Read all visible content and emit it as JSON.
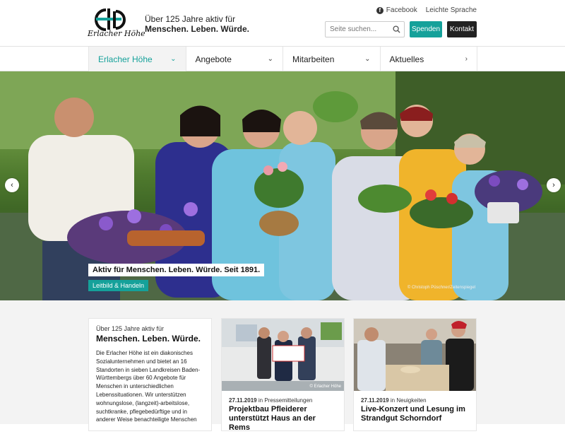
{
  "header": {
    "logo_script": "Erlacher Höhe",
    "tagline_line1": "Über 125 Jahre aktiv für",
    "tagline_line2": "Menschen. Leben. Würde.",
    "facebook_label": "Facebook",
    "easy_language_label": "Leichte Sprache",
    "search_placeholder": "Seite suchen...",
    "donate_label": "Spenden",
    "contact_label": "Kontakt",
    "accent_color": "#15a19a"
  },
  "nav": {
    "items": [
      {
        "label": "Erlacher Höhe",
        "icon": "chevron-down-icon",
        "active": true
      },
      {
        "label": "Angebote",
        "icon": "chevron-down-icon"
      },
      {
        "label": "Mitarbeiten",
        "icon": "chevron-down-icon"
      },
      {
        "label": "Aktuelles",
        "icon": "chevron-right-icon"
      }
    ]
  },
  "hero": {
    "caption": "Aktiv für Menschen. Leben. Würde. Seit 1891.",
    "tag": "Leitbild & Handeln",
    "credit": "© Christoph Püschner/Zeitenspiegel",
    "prev_icon": "chevron-left-icon",
    "next_icon": "chevron-right-icon"
  },
  "intro": {
    "sub": "Über 125 Jahre aktiv für",
    "head": "Menschen. Leben. Würde.",
    "body": "Die Erlacher Höhe ist ein diakonisches Sozialunternehmen und bietet an 16 Standorten in sieben Landkreisen Baden-Württembergs über 60 Angebote für Menschen in unterschiedlichen Lebenssituationen. Wir unterstützen wohnungslose, (langzeit)-arbeitslose, suchtkranke, pflegebedürftige und in anderer Weise benachteiligte Menschen"
  },
  "news": [
    {
      "date": "27.11.2019",
      "category_prefix": "in",
      "category": "Pressemitteilungen",
      "title": "Projektbau Pfleiderer unterstützt Haus an der Rems",
      "img_credit": "© Erlacher Höhe"
    },
    {
      "date": "27.11.2019",
      "category_prefix": "in",
      "category": "Neuigkeiten",
      "title": "Live-Konzert und Lesung im Strandgut Schorndorf"
    }
  ]
}
